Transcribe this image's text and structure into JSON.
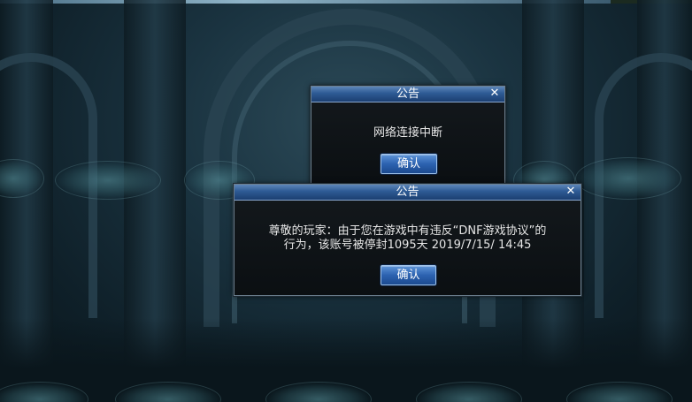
{
  "dialogs": [
    {
      "title": "公告",
      "close_icon": "close-icon",
      "message": "网络连接中断",
      "confirm_label": "确认"
    },
    {
      "title": "公告",
      "close_icon": "close-icon",
      "message_line1": "尊敬的玩家：由于您在游戏中有违反“DNF游戏协议”的",
      "message_line2": "行为，该账号被停封1095天 2019/7/15/ 14:45",
      "confirm_label": "确认"
    }
  ],
  "colors": {
    "title_bar": "#2d5a94",
    "button": "#2c62b0",
    "dialog_bg": "#0b0f12",
    "text": "#e6e6e6"
  }
}
